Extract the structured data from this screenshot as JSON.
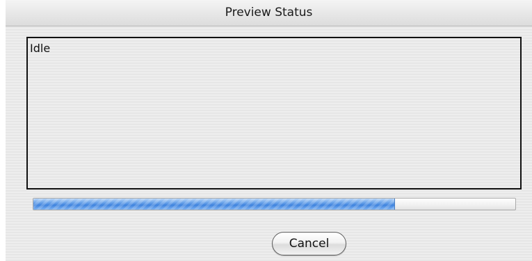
{
  "window": {
    "title": "Preview Status"
  },
  "status": {
    "text": "Idle"
  },
  "progress": {
    "value_percent": 75,
    "color": "#3e83de"
  },
  "actions": {
    "cancel_label": "Cancel"
  }
}
